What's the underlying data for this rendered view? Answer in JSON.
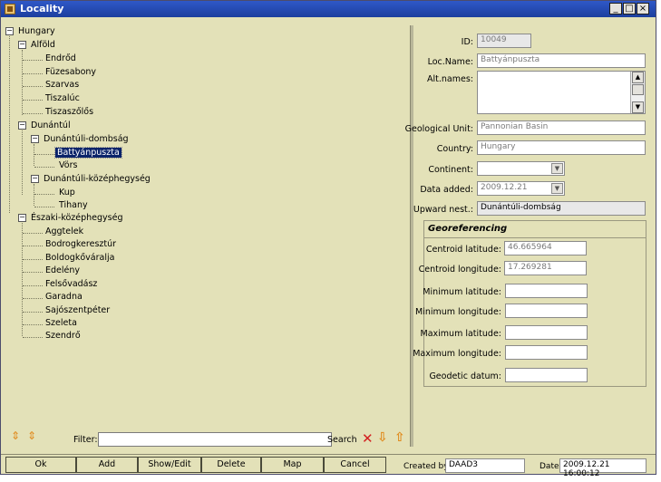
{
  "window": {
    "title": "Locality",
    "minimize": "_",
    "maximize": "□",
    "close": "×"
  },
  "tree": {
    "nodes": [
      {
        "label": "Hungary",
        "toggle": "−"
      },
      {
        "label": "Alföld",
        "toggle": "−"
      },
      {
        "label": "Endrőd"
      },
      {
        "label": "Füzesabony"
      },
      {
        "label": "Szarvas"
      },
      {
        "label": "Tiszalúc"
      },
      {
        "label": "Tiszaszőlős"
      },
      {
        "label": "Dunántúl",
        "toggle": "−"
      },
      {
        "label": "Dunántúli-dombság",
        "toggle": "−"
      },
      {
        "label": "Battyánpuszta"
      },
      {
        "label": "Vörs"
      },
      {
        "label": "Dunántúli-középhegység",
        "toggle": "−"
      },
      {
        "label": "Kup"
      },
      {
        "label": "Tihany"
      },
      {
        "label": "Északi-középhegység",
        "toggle": "−"
      },
      {
        "label": "Aggtelek"
      },
      {
        "label": "Bodrogkeresztúr"
      },
      {
        "label": "Boldogkőváralja"
      },
      {
        "label": "Edelény"
      },
      {
        "label": "Felsővadász"
      },
      {
        "label": "Garadna"
      },
      {
        "label": "Sajószentpéter"
      },
      {
        "label": "Szeleta"
      },
      {
        "label": "Szendrő"
      }
    ]
  },
  "filter": {
    "label": "Filter:",
    "value": "",
    "search_label": "Search",
    "expand_glyph": "⇕",
    "clear_glyph": "✕",
    "down_glyph": "⇩",
    "up_glyph": "⇧"
  },
  "form": {
    "id_label": "ID:",
    "id_value": "10049",
    "locname_label": "Loc.Name:",
    "locname_value": "Battyánpuszta",
    "altnames_label": "Alt.names:",
    "altnames_value": "",
    "geounit_label": "Geological Unit:",
    "geounit_value": "Pannonian Basin",
    "country_label": "Country:",
    "country_value": "Hungary",
    "continent_label": "Continent:",
    "continent_value": "",
    "dateadded_label": "Data added:",
    "dateadded_value": "2009.12.21",
    "upward_label": "Upward nest.:",
    "upward_value": "Dunántúli-dombság",
    "dropdown_glyph": "▼",
    "scroll_up_glyph": "▲",
    "scroll_down_glyph": "▼"
  },
  "georef": {
    "title": "Georeferencing",
    "centroid_lat_label": "Centroid latitude:",
    "centroid_lat_value": "46.665964",
    "centroid_lon_label": "Centroid longitude:",
    "centroid_lon_value": "17.269281",
    "min_lat_label": "Minimum latitude:",
    "min_lat_value": "",
    "min_lon_label": "Minimum longitude:",
    "min_lon_value": "",
    "max_lat_label": "Maximum latitude:",
    "max_lat_value": "",
    "max_lon_label": "Maximum longitude:",
    "max_lon_value": "",
    "datum_label": "Geodetic datum:",
    "datum_value": ""
  },
  "buttons": {
    "ok": "Ok",
    "add": "Add",
    "show_edit": "Show/Edit",
    "delete": "Delete",
    "map": "Map",
    "cancel": "Cancel"
  },
  "status": {
    "created_by_label": "Created by:",
    "created_by_value": "DAAD3",
    "date_label": "Date:",
    "date_value": "2009.12.21 16:00:12"
  },
  "colors": {
    "window_bg": "#e3e1b8",
    "titlebar": "#1c3f9e",
    "selection": "#0b246a",
    "delete_icon": "#d32020",
    "arrow_icon": "#e08a1c"
  }
}
